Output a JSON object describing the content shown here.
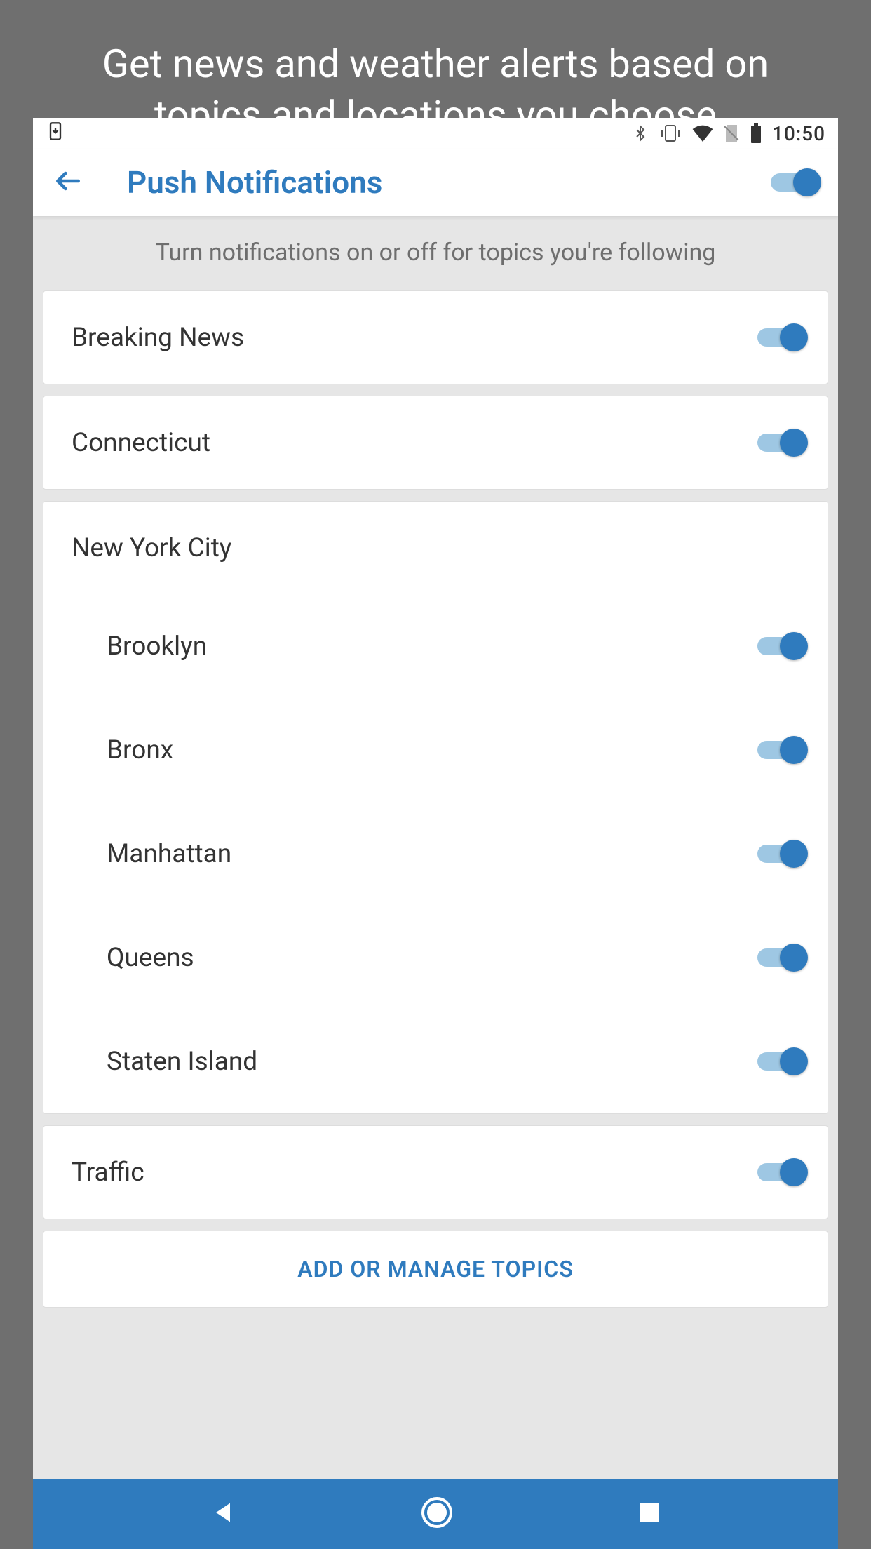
{
  "promo": "Get news and weather alerts based on topics and locations you choose",
  "statusbar": {
    "time": "10:50"
  },
  "header": {
    "title": "Push Notifications"
  },
  "subtitle": "Turn notifications on or off for topics you're following",
  "topics": {
    "breaking_news": "Breaking News",
    "connecticut": "Connecticut",
    "nyc": {
      "label": "New York City",
      "items": [
        "Brooklyn",
        "Bronx",
        "Manhattan",
        "Queens",
        "Staten Island"
      ]
    },
    "traffic": "Traffic"
  },
  "manage_button": "ADD OR MANAGE TOPICS"
}
